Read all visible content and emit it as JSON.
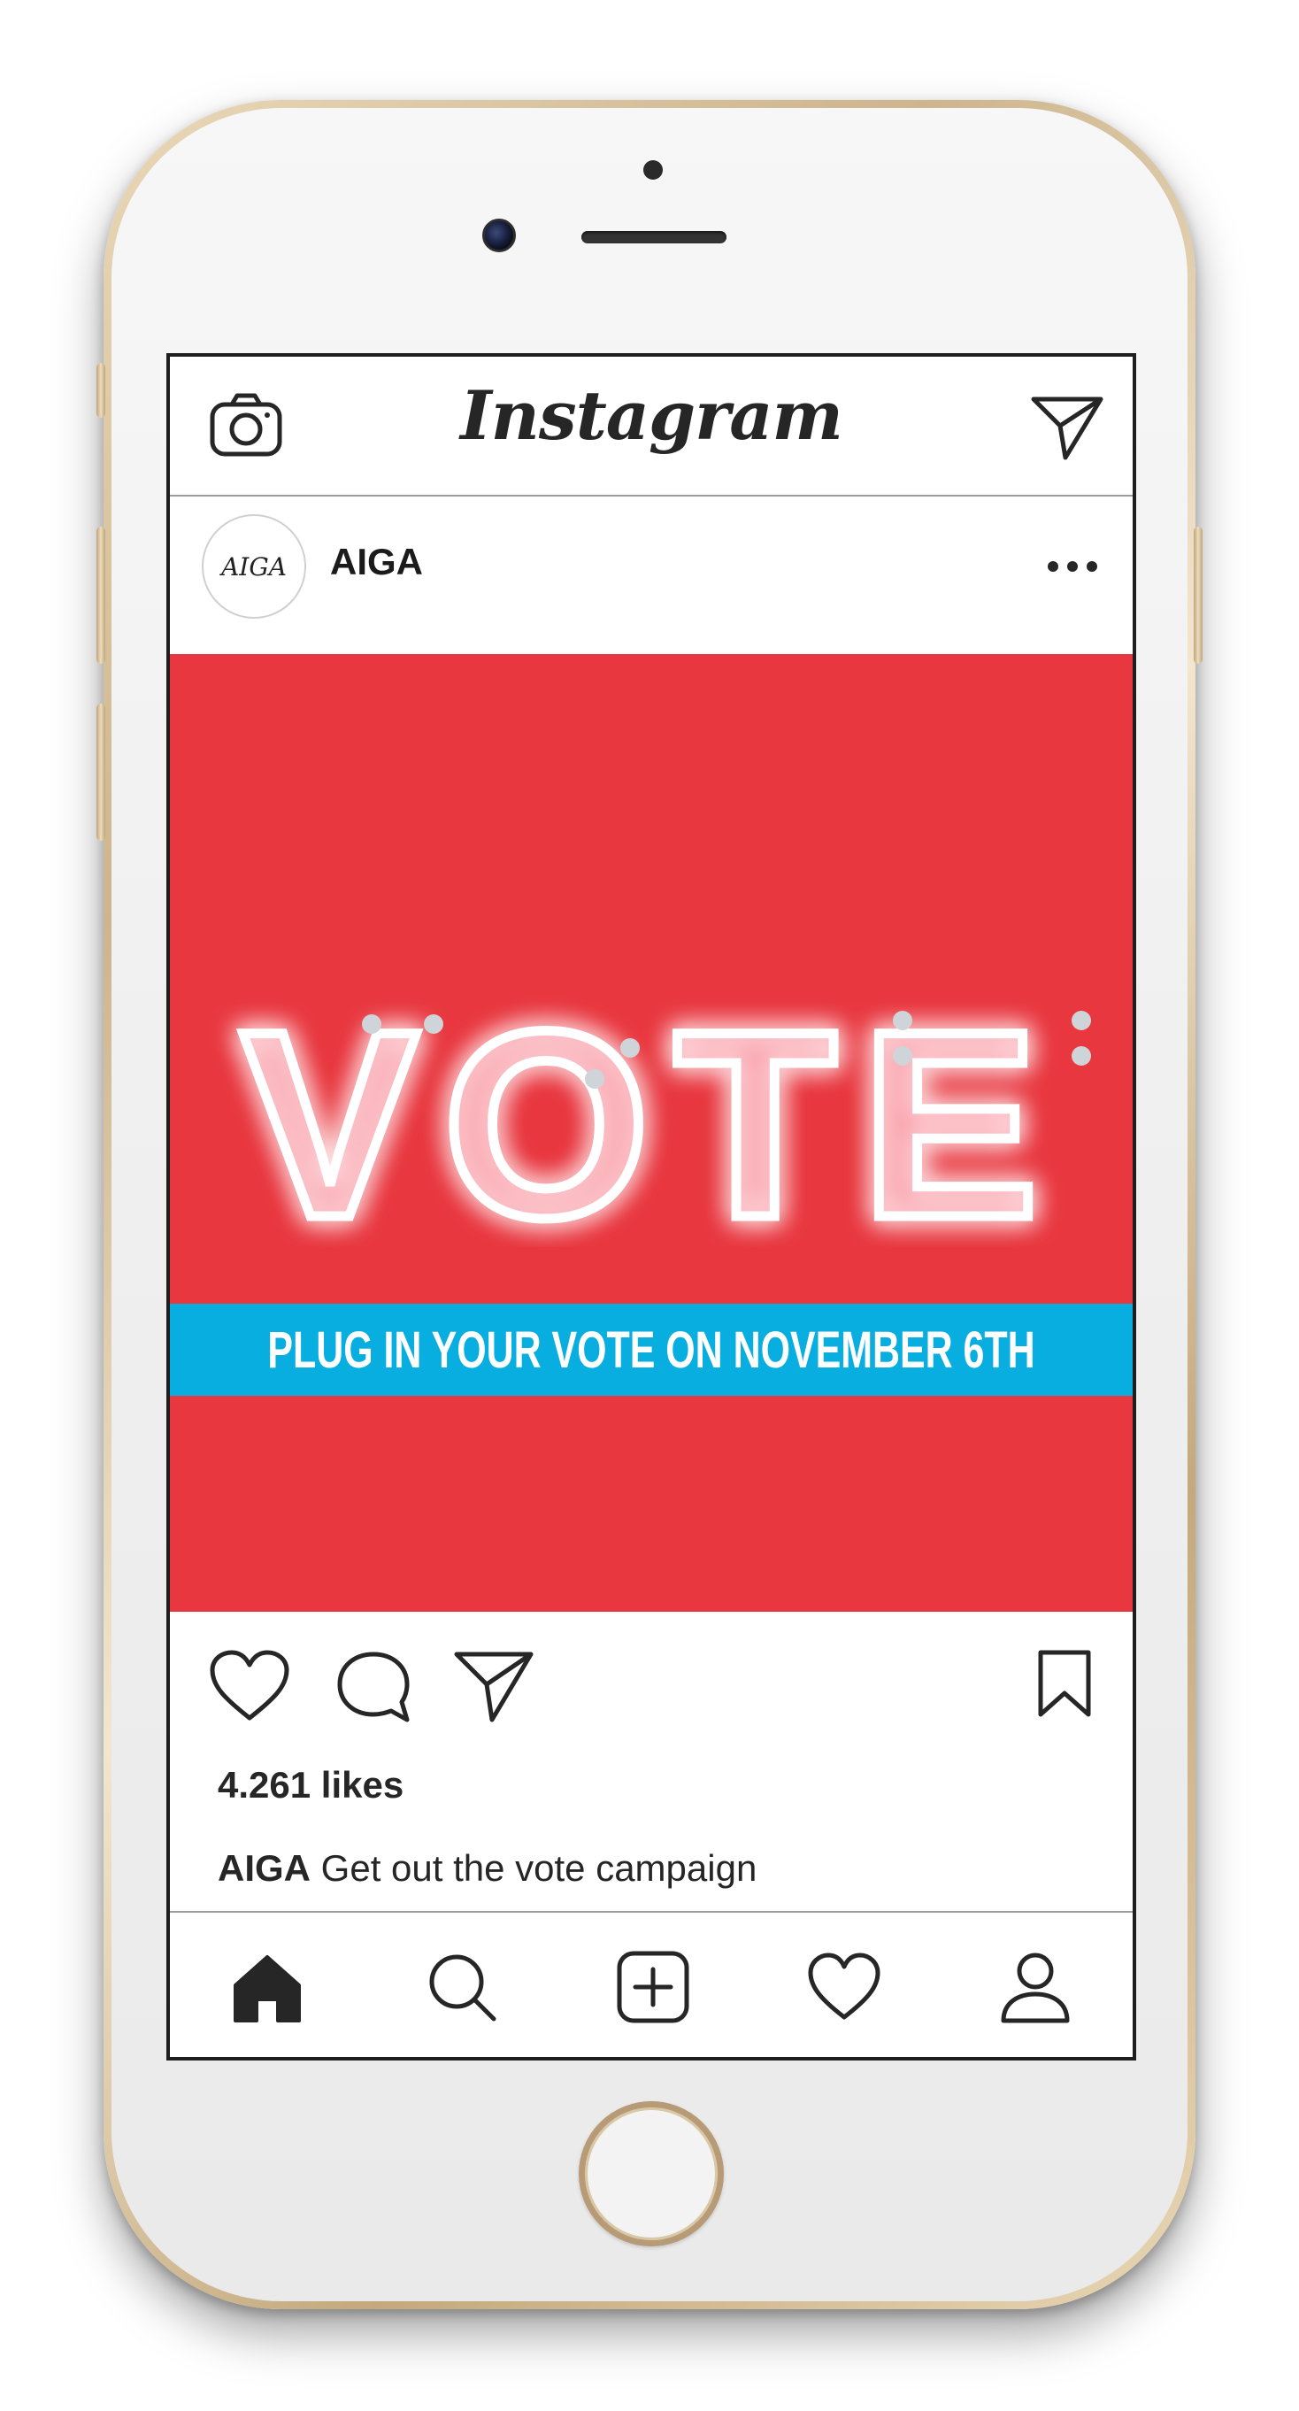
{
  "app": {
    "title": "Instagram"
  },
  "top_bar": {
    "camera_icon": "camera-icon",
    "direct_icon": "paper-plane-icon"
  },
  "post": {
    "avatar_text": "AIGA",
    "username": "AIGA",
    "more_icon": "more-dots-icon",
    "image": {
      "headline": "VOTE",
      "banner": "PLUG IN YOUR VOTE ON NOVEMBER 6TH",
      "colors": {
        "background": "#e8373f",
        "banner": "#09aee0",
        "text": "#ffffff"
      }
    },
    "actions": {
      "like_icon": "heart-icon",
      "comment_icon": "comment-icon",
      "share_icon": "paper-plane-icon",
      "save_icon": "bookmark-icon"
    },
    "likes": "4.261 likes",
    "caption": {
      "user": "AIGA",
      "text": "Get out the vote campaign"
    }
  },
  "bottom_nav": {
    "items": [
      "home-icon",
      "search-icon",
      "add-post-icon",
      "activity-heart-icon",
      "profile-icon"
    ]
  }
}
